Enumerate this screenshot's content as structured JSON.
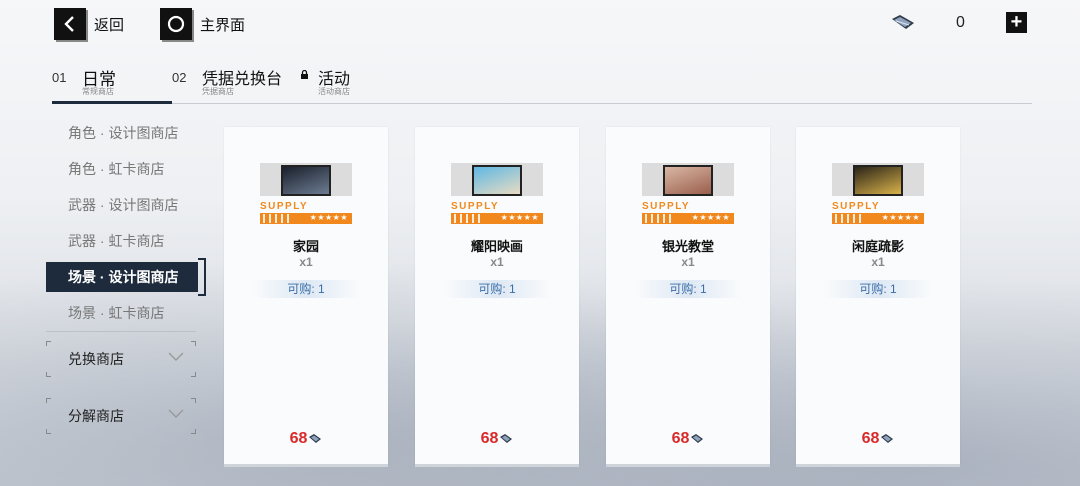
{
  "header": {
    "back_label": "返回",
    "home_label": "主界面",
    "currency_amount": "0"
  },
  "tabs": [
    {
      "num": "01",
      "title": "日常",
      "sub": "常规商店",
      "locked": false
    },
    {
      "num": "02",
      "title": "凭据兑换台",
      "sub": "凭据商店",
      "locked": false
    },
    {
      "num": "",
      "title": "活动",
      "sub": "活动商店",
      "locked": true
    }
  ],
  "sidebar": {
    "items": [
      {
        "label": "角色 · 设计图商店"
      },
      {
        "label": "角色 · 虹卡商店"
      },
      {
        "label": "武器 · 设计图商店"
      },
      {
        "label": "武器 · 虹卡商店"
      },
      {
        "label": "场景 · 设计图商店"
      },
      {
        "label": "场景 · 虹卡商店"
      }
    ],
    "active_index": 4,
    "expanders": [
      {
        "label": "兑换商店"
      },
      {
        "label": "分解商店"
      }
    ]
  },
  "cards": [
    {
      "supply": "SUPPLY",
      "stars": "★★★★★",
      "name": "家园",
      "qty": "x1",
      "limit": "可购: 1",
      "price": "68",
      "thumb_colors": [
        "#1a1f2b",
        "#6d7d93"
      ]
    },
    {
      "supply": "SUPPLY",
      "stars": "★★★★★",
      "name": "耀阳映画",
      "qty": "x1",
      "limit": "可购: 1",
      "price": "68",
      "thumb_colors": [
        "#5fb7e4",
        "#e8dcc2"
      ]
    },
    {
      "supply": "SUPPLY",
      "stars": "★★★★★",
      "name": "银光教堂",
      "qty": "x1",
      "limit": "可购: 1",
      "price": "68",
      "thumb_colors": [
        "#d9b7a4",
        "#9a5f4c"
      ]
    },
    {
      "supply": "SUPPLY",
      "stars": "★★★★★",
      "name": "闲庭疏影",
      "qty": "x1",
      "limit": "可购: 1",
      "price": "68",
      "thumb_colors": [
        "#2a2418",
        "#d9b24a"
      ]
    }
  ],
  "colors": {
    "accent_dark": "#1d2b3c",
    "supply_orange": "#f0881e",
    "price_red": "#d82a2a",
    "limit_blue": "#3b6ea8"
  },
  "icons": {
    "back": "chevron-left-icon",
    "home": "circle-icon",
    "currency": "gem-icon",
    "add": "plus-icon",
    "lock": "lock-icon",
    "expand": "chevron-down-icon"
  }
}
